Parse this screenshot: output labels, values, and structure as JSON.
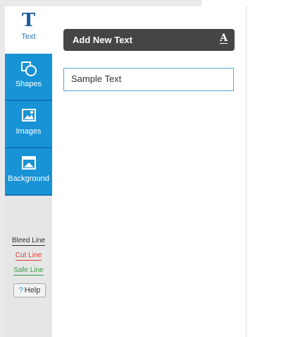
{
  "sidebar": {
    "tabs": [
      {
        "label": "Text",
        "icon": "text-T-icon"
      },
      {
        "label": "Shapes",
        "icon": "shapes-icon"
      },
      {
        "label": "Images",
        "icon": "image-icon"
      },
      {
        "label": "Background",
        "icon": "background-icon"
      }
    ],
    "legend": {
      "bleed": "Bleed Line",
      "cut": "Cut Line",
      "safe": "Safe Line"
    },
    "help_label": "Help",
    "help_icon_glyph": "?"
  },
  "panel": {
    "header_title": "Add New Text",
    "header_icon": "A",
    "text_value": "Sample Text"
  },
  "colors": {
    "tab_blue": "#1793d6",
    "bleed": "#333333",
    "cut": "#e03c31",
    "safe": "#2e9e3c"
  }
}
